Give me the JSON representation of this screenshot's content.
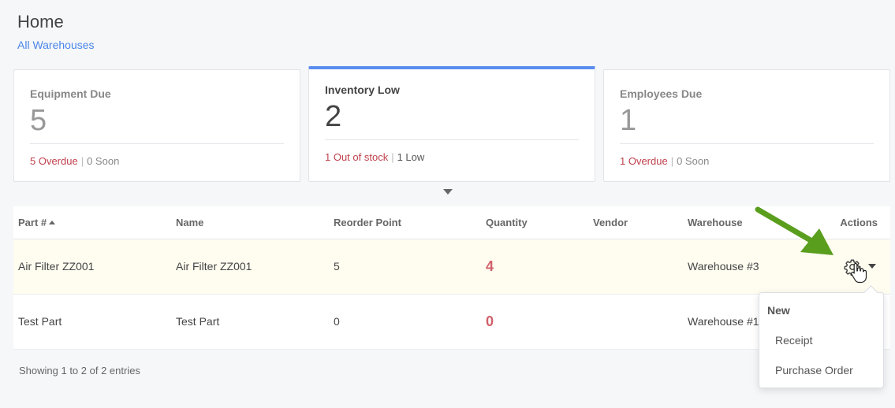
{
  "header": {
    "title": "Home",
    "subtitle_link": "All Warehouses"
  },
  "cards": [
    {
      "title": "Equipment Due",
      "value": "5",
      "foot_primary": "5 Overdue",
      "foot_secondary": "0 Soon",
      "active": false
    },
    {
      "title": "Inventory Low",
      "value": "2",
      "foot_primary": "1 Out of stock",
      "foot_secondary": "1 Low",
      "active": true
    },
    {
      "title": "Employees Due",
      "value": "1",
      "foot_primary": "1 Overdue",
      "foot_secondary": "0 Soon",
      "active": false
    }
  ],
  "table": {
    "columns": [
      "Part #",
      "Name",
      "Reorder Point",
      "Quantity",
      "Vendor",
      "Warehouse",
      "Actions"
    ],
    "rows": [
      {
        "part": "Air Filter ZZ001",
        "name": "Air Filter ZZ001",
        "reorder": "5",
        "quantity": "4",
        "vendor": "",
        "warehouse": "Warehouse #3"
      },
      {
        "part": "Test Part",
        "name": "Test Part",
        "reorder": "0",
        "quantity": "0",
        "vendor": "",
        "warehouse": "Warehouse #1"
      }
    ]
  },
  "footer": {
    "info": "Showing 1 to 2 of 2 entries"
  },
  "actions_menu": {
    "header": "New",
    "items": [
      "Receipt",
      "Purchase Order"
    ]
  },
  "icons": {
    "gear": "gear-icon",
    "caret": "chevron-down-icon",
    "pointer": "hand-pointer-icon",
    "annotation": "green-arrow-annotation"
  },
  "colors": {
    "accent": "#5b8def",
    "link": "#4a86e8",
    "danger": "#c0404c",
    "quantity": "#d0606a",
    "annotation_arrow": "#5a9e1e",
    "row_highlight": "#fffdf0"
  }
}
